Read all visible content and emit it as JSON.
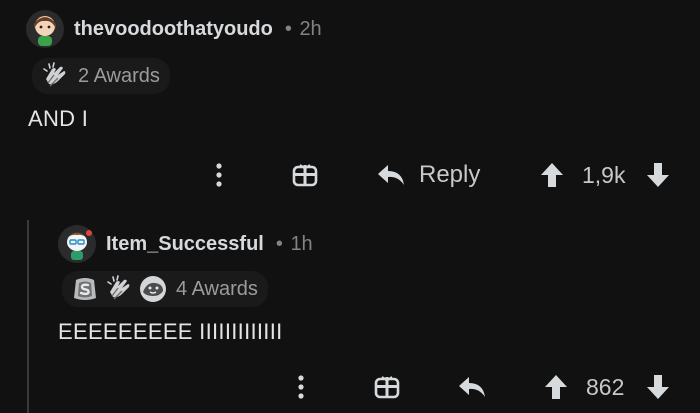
{
  "comments": [
    {
      "username": "thevoodoothatyoudo",
      "separator": "•",
      "time": "2h",
      "awards": {
        "icons": [
          "clapping-hands-award"
        ],
        "count_label": "2 Awards"
      },
      "body": "AND I",
      "actions": {
        "reply_label": "Reply",
        "score": "1,9k"
      }
    },
    {
      "username": "Item_Successful",
      "separator": "•",
      "time": "1h",
      "awards": {
        "icons": [
          "silver-award",
          "clapping-hands-award",
          "wholesome-seal-award"
        ],
        "count_label": "4 Awards"
      },
      "body": "EEEEEEEEE IIIIIIIIIIIII",
      "actions": {
        "score": "862"
      }
    }
  ],
  "colors": {
    "background": "#111112",
    "text": "#d7dadc",
    "muted": "#818384",
    "thread_line": "#3a3a3c"
  }
}
